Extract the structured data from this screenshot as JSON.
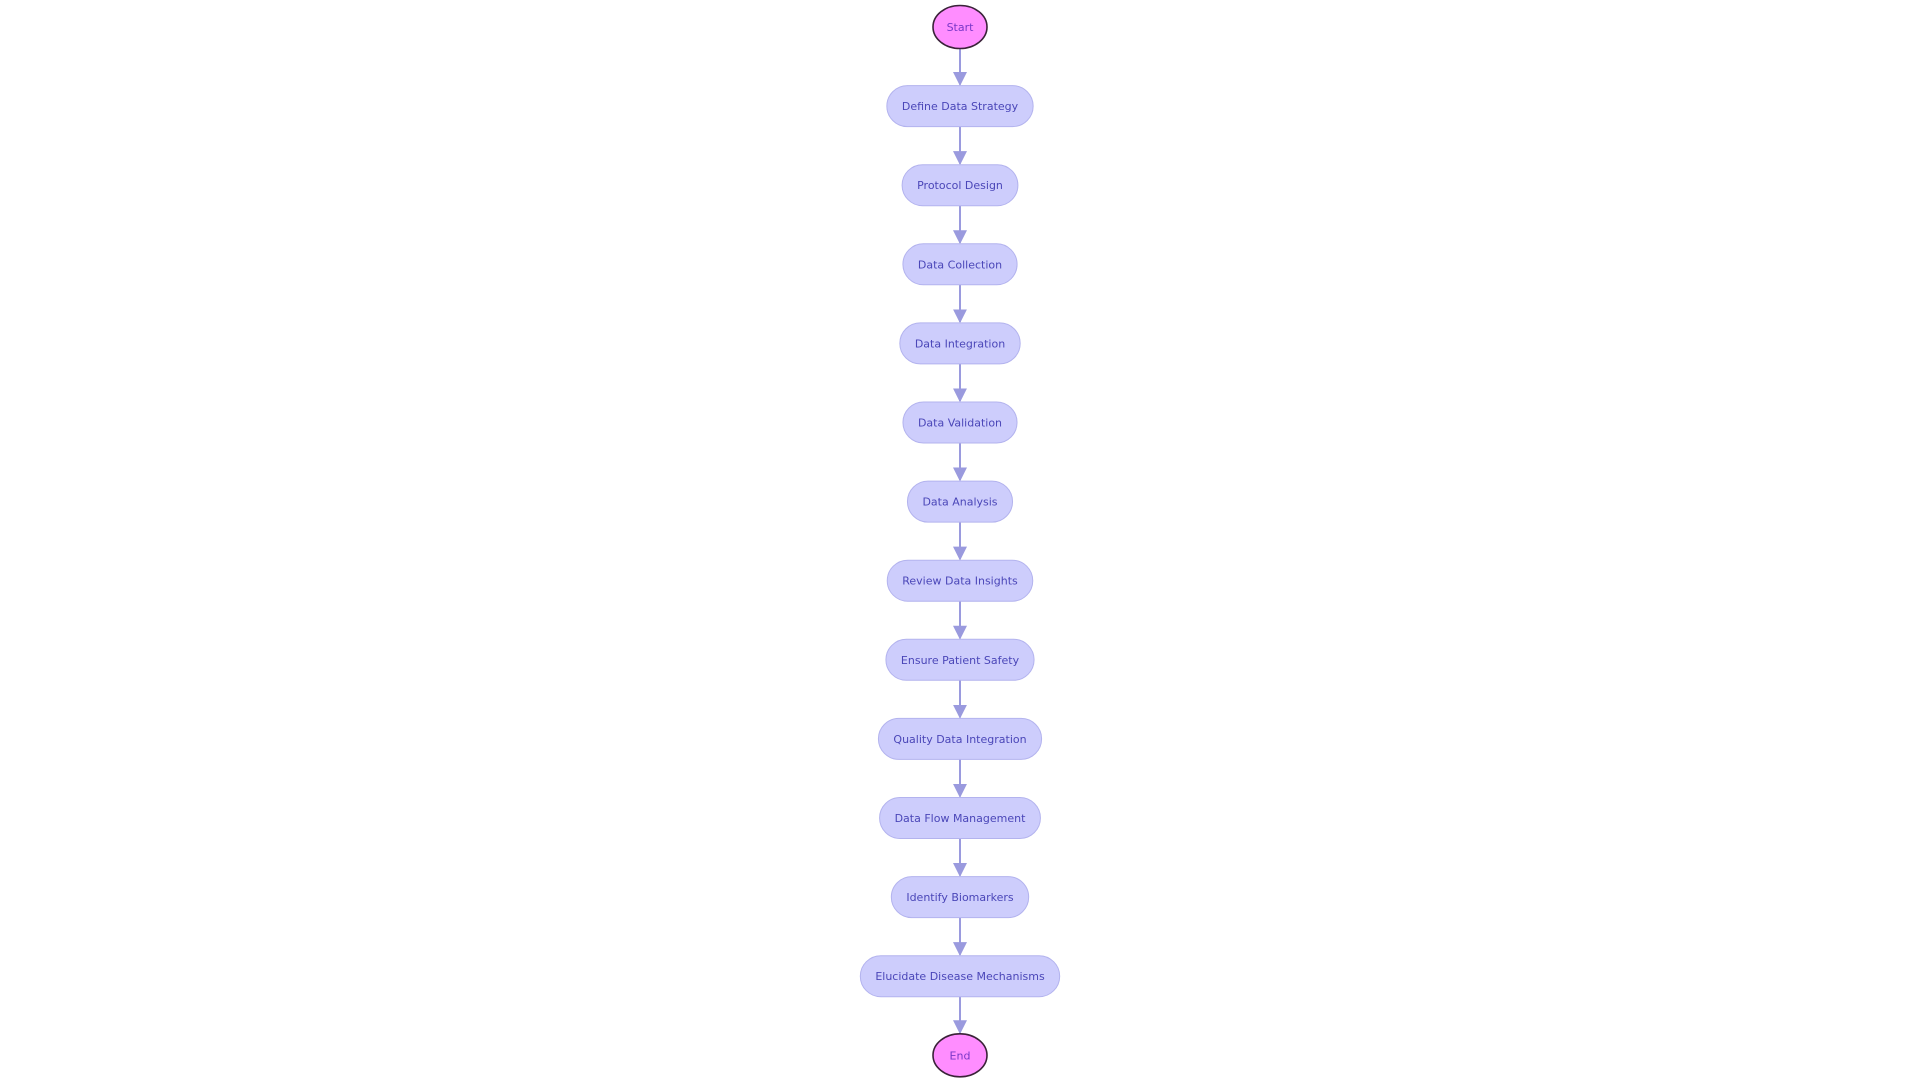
{
  "diagram": {
    "type": "flowchart",
    "direction": "top-to-bottom",
    "colors": {
      "process_fill": "#cdcdfc",
      "process_stroke": "#b3b3ee",
      "process_text": "#4a46b8",
      "terminal_fill": "#ff8dff",
      "terminal_stroke": "#3a2238",
      "terminal_text": "#7a38c8",
      "edge": "#9a9ade"
    },
    "nodes": [
      {
        "id": "start",
        "label": "Start",
        "shape": "terminal"
      },
      {
        "id": "define-data-strategy",
        "label": "Define Data Strategy",
        "shape": "process"
      },
      {
        "id": "protocol-design",
        "label": "Protocol Design",
        "shape": "process"
      },
      {
        "id": "data-collection",
        "label": "Data Collection",
        "shape": "process"
      },
      {
        "id": "data-integration",
        "label": "Data Integration",
        "shape": "process"
      },
      {
        "id": "data-validation",
        "label": "Data Validation",
        "shape": "process"
      },
      {
        "id": "data-analysis",
        "label": "Data Analysis",
        "shape": "process"
      },
      {
        "id": "review-data-insights",
        "label": "Review Data Insights",
        "shape": "process"
      },
      {
        "id": "ensure-patient-safety",
        "label": "Ensure Patient Safety",
        "shape": "process"
      },
      {
        "id": "quality-data-integration",
        "label": "Quality Data Integration",
        "shape": "process"
      },
      {
        "id": "data-flow-management",
        "label": "Data Flow Management",
        "shape": "process"
      },
      {
        "id": "identify-biomarkers",
        "label": "Identify Biomarkers",
        "shape": "process"
      },
      {
        "id": "elucidate-disease-mechanisms",
        "label": "Elucidate Disease Mechanisms",
        "shape": "process"
      },
      {
        "id": "end",
        "label": "End",
        "shape": "terminal"
      }
    ],
    "edges": [
      {
        "from": "start",
        "to": "define-data-strategy"
      },
      {
        "from": "define-data-strategy",
        "to": "protocol-design"
      },
      {
        "from": "protocol-design",
        "to": "data-collection"
      },
      {
        "from": "data-collection",
        "to": "data-integration"
      },
      {
        "from": "data-integration",
        "to": "data-validation"
      },
      {
        "from": "data-validation",
        "to": "data-analysis"
      },
      {
        "from": "data-analysis",
        "to": "review-data-insights"
      },
      {
        "from": "review-data-insights",
        "to": "ensure-patient-safety"
      },
      {
        "from": "ensure-patient-safety",
        "to": "quality-data-integration"
      },
      {
        "from": "quality-data-integration",
        "to": "data-flow-management"
      },
      {
        "from": "data-flow-management",
        "to": "identify-biomarkers"
      },
      {
        "from": "identify-biomarkers",
        "to": "elucidate-disease-mechanisms"
      },
      {
        "from": "elucidate-disease-mechanisms",
        "to": "end"
      }
    ]
  }
}
